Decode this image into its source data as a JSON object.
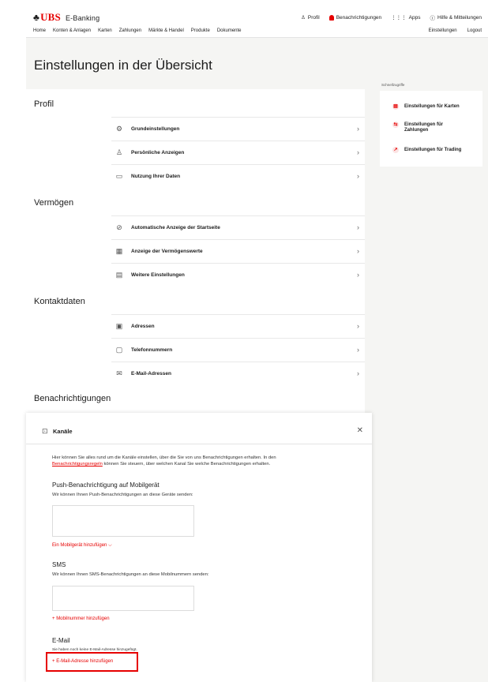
{
  "header": {
    "brand": "UBS",
    "brand_keys": "♣",
    "app_name": "E-Banking",
    "links": [
      {
        "icon": "person-icon",
        "label": "Profil"
      },
      {
        "icon": "bell-icon",
        "label": "Benachrichtigungen"
      },
      {
        "icon": "apps-grid-icon",
        "label": "Apps"
      },
      {
        "icon": "help-icon",
        "label": "Hilfe & Mitteilungen"
      }
    ]
  },
  "nav": {
    "items": [
      "Home",
      "Konten & Anlagen",
      "Karten",
      "Zahlungen",
      "Märkte & Handel",
      "Produkte",
      "Dokumente"
    ],
    "right": [
      "Einstellungen",
      "Logout"
    ]
  },
  "page_title": "Einstellungen in der Übersicht",
  "quick_access": {
    "label": "Schnellzugriffe",
    "items": [
      {
        "icon": "card-icon",
        "label": "Einstellungen für Karten"
      },
      {
        "icon": "payment-icon",
        "label": "Einstellungen für Zahlungen"
      },
      {
        "icon": "trading-icon",
        "label": "Einstellungen für Trading"
      }
    ]
  },
  "sections": [
    {
      "title": "Profil",
      "rows": [
        {
          "icon": "settings-gear-icon",
          "label": "Grundeinstellungen"
        },
        {
          "icon": "persons-icon",
          "label": "Persönliche Anzeigen"
        },
        {
          "icon": "data-usage-icon",
          "label": "Nutzung Ihrer Daten"
        }
      ]
    },
    {
      "title": "Vermögen",
      "rows": [
        {
          "icon": "eye-off-icon",
          "label": "Automatische Anzeige der Startseite"
        },
        {
          "icon": "assets-icon",
          "label": "Anzeige der Vermögenswerte"
        },
        {
          "icon": "more-settings-icon",
          "label": "Weitere Einstellungen"
        }
      ]
    },
    {
      "title": "Kontaktdaten",
      "rows": [
        {
          "icon": "address-icon",
          "label": "Adressen"
        },
        {
          "icon": "phone-icon",
          "label": "Telefonnummern"
        },
        {
          "icon": "email-icon",
          "label": "E-Mail-Adressen"
        }
      ]
    },
    {
      "title": "Benachrichtigungen",
      "rows": []
    }
  ],
  "panel": {
    "title": "Kanäle",
    "intro_pre": "Hier können Sie alles rund um die Kanäle einstellen, über die Sie von uns Benachrichtigungen erhalten. In den",
    "intro_link": "Benachrichtigungsregeln",
    "intro_post": "können Sie steuern, über welchen Kanal Sie welche Benachrichtigungen erhalten.",
    "push": {
      "title": "Push-Benachrichtigung auf Mobilgerät",
      "text": "Wir können Ihnen Push-Benachrichtigungen an diese Geräte senden:",
      "add_label": "Ein Mobilgerät hinzufügen"
    },
    "sms": {
      "title": "SMS",
      "text": "Wir können Ihnen SMS-Benachrichtigungen an diese Mobilnummern senden:",
      "add_label": "Mobilnummer hinzufügen"
    },
    "email": {
      "title": "E-Mail",
      "text": "Sie haben noch keine E-Mail-Adresse hinzugefügt.",
      "add_label": "E-Mail-Adresse hinzufügen"
    }
  },
  "colors": {
    "accent": "#e60000",
    "background": "#f5f5f3"
  }
}
